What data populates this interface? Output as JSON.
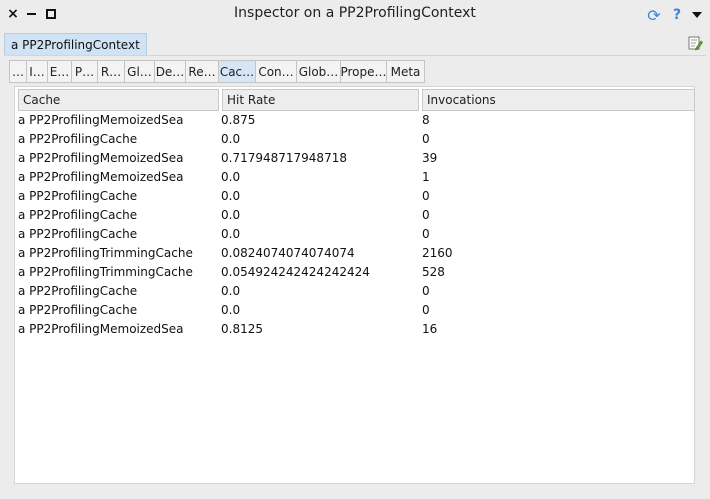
{
  "window": {
    "title": "Inspector on a PP2ProfilingContext",
    "close_glyph": "×",
    "help_glyph": "?",
    "refresh_glyph": "⟳"
  },
  "object_tab": {
    "label": "a PP2ProfilingContext"
  },
  "presentation_tabs": [
    {
      "label": "…"
    },
    {
      "label": "I…"
    },
    {
      "label": "E…"
    },
    {
      "label": "P…"
    },
    {
      "label": "R…"
    },
    {
      "label": "Gl…"
    },
    {
      "label": "De…"
    },
    {
      "label": "Re…"
    },
    {
      "label": "Cac…"
    },
    {
      "label": "Con…"
    },
    {
      "label": "Glob…"
    },
    {
      "label": "Prope…"
    },
    {
      "label": "Meta"
    }
  ],
  "active_tab_index": 8,
  "table": {
    "columns": [
      "Cache",
      "Hit Rate",
      "Invocations"
    ],
    "rows": [
      [
        "a PP2ProfilingMemoizedSea",
        "0.875",
        "8"
      ],
      [
        "a PP2ProfilingCache",
        "0.0",
        "0"
      ],
      [
        "a PP2ProfilingMemoizedSea",
        "0.717948717948718",
        "39"
      ],
      [
        "a PP2ProfilingMemoizedSea",
        "0.0",
        "1"
      ],
      [
        "a PP2ProfilingCache",
        "0.0",
        "0"
      ],
      [
        "a PP2ProfilingCache",
        "0.0",
        "0"
      ],
      [
        "a PP2ProfilingCache",
        "0.0",
        "0"
      ],
      [
        "a PP2ProfilingTrimmingCache",
        "0.0824074074074074",
        "2160"
      ],
      [
        "a PP2ProfilingTrimmingCache",
        "0.054924242424242424",
        "528"
      ],
      [
        "a PP2ProfilingCache",
        "0.0",
        "0"
      ],
      [
        "a PP2ProfilingCache",
        "0.0",
        "0"
      ],
      [
        "a PP2ProfilingMemoizedSea",
        "0.8125",
        "16"
      ]
    ]
  },
  "colors": {
    "accent_blue": "#3b86d6",
    "active_tab": "#d6e6f5",
    "object_tab": "#cfe3f5"
  }
}
